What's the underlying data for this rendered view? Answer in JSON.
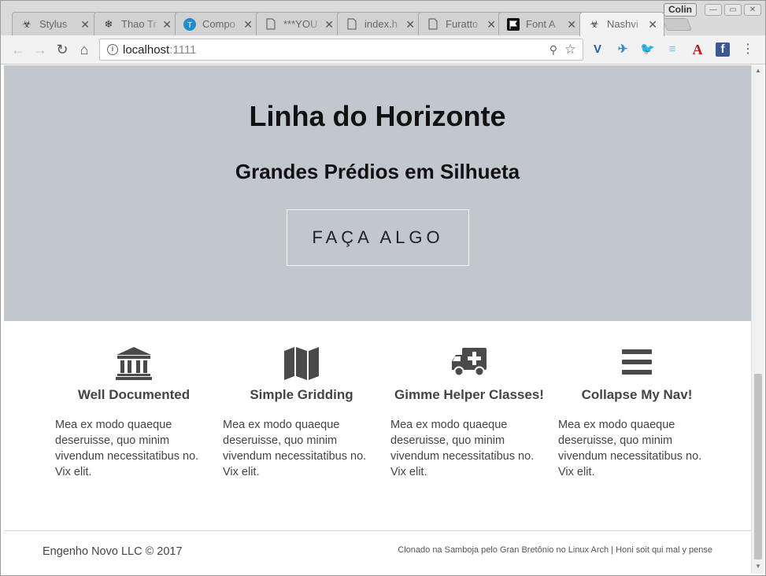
{
  "browser": {
    "profile_name": "Colin",
    "tabs": [
      {
        "title": "Stylus",
        "icon": "biohazard-icon",
        "active": false
      },
      {
        "title": "Thao Tr",
        "icon": "snowflake-icon",
        "active": false
      },
      {
        "title": "Compo",
        "icon": "t-circle-icon",
        "active": false
      },
      {
        "title": "***YOU",
        "icon": "document-icon",
        "active": false
      },
      {
        "title": "index.h",
        "icon": "document-icon",
        "active": false
      },
      {
        "title": "Furatto",
        "icon": "document-icon",
        "active": false
      },
      {
        "title": "Font A",
        "icon": "flag-icon",
        "active": false
      },
      {
        "title": "Nashvi",
        "icon": "biohazard-icon",
        "active": true
      }
    ],
    "address": {
      "host": "localhost",
      "port": ":1111"
    }
  },
  "page": {
    "hero": {
      "title": "Linha do Horizonte",
      "subtitle": "Grandes Prédios em Silhueta",
      "cta_label": "FAÇA ALGO"
    },
    "features": [
      {
        "icon": "bank-icon",
        "title": "Well Documented",
        "text": "Mea ex modo quaeque deseruisse, quo minim vivendum necessitatibus no. Vix elit."
      },
      {
        "icon": "map-icon",
        "title": "Simple Gridding",
        "text": "Mea ex modo quaeque deseruisse, quo minim vivendum necessitatibus no. Vix elit."
      },
      {
        "icon": "ambulance-icon",
        "title": "Gimme Helper Classes!",
        "text": "Mea ex modo quaeque deseruisse, quo minim vivendum necessitatibus no. Vix elit."
      },
      {
        "icon": "hamburger-menu-icon",
        "title": "Collapse My Nav!",
        "text": "Mea ex modo quaeque deseruisse, quo minim vivendum necessitatibus no. Vix elit."
      }
    ],
    "footer": {
      "copyright": "Engenho Novo LLC © 2017",
      "credit": "Clonado na Samboja pelo Gran Bretônio no Linux Arch | Honi soit qui mal y pense"
    }
  },
  "colors": {
    "hero_background": "#c2c6cd",
    "icon_color": "#4a4a4a",
    "text_color": "#444444"
  }
}
